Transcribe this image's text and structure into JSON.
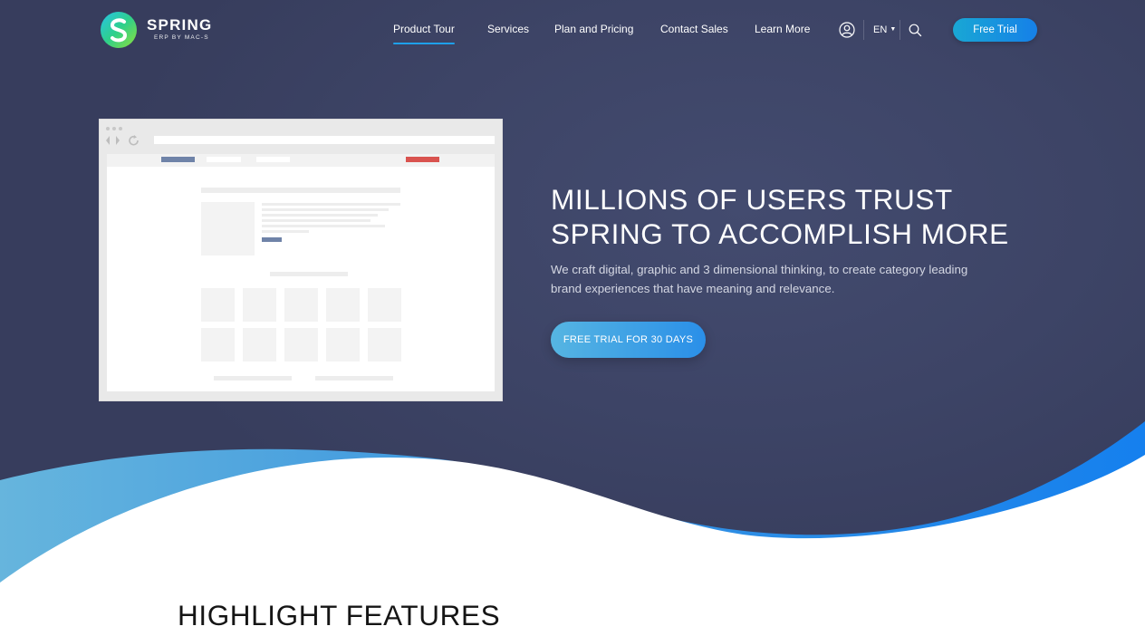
{
  "brand": {
    "name": "SPRING",
    "tagline": "ERP BY MAC-S",
    "logo_icon": "spring-logo-icon"
  },
  "nav": {
    "items": [
      {
        "label": "Product Tour",
        "active": true
      },
      {
        "label": "Services",
        "active": false
      },
      {
        "label": "Plan and Pricing",
        "active": false
      },
      {
        "label": "Contact Sales",
        "active": false
      },
      {
        "label": "Learn More",
        "active": false
      }
    ],
    "account_icon": "user-icon",
    "language": "EN",
    "language_icon": "caret-down-icon",
    "search_icon": "search-icon",
    "free_trial_label": "Free Trial"
  },
  "hero": {
    "title_line1": "MILLIONS OF USERS TRUST",
    "title_line2": "SPRING TO ACCOMPLISH MORE",
    "description_line1": "We craft digital, graphic and 3 dimensional thinking, to create category leading",
    "description_line2": "brand experiences that have meaning and relevance.",
    "cta_label": "FREE TRIAL FOR 30 DAYS"
  },
  "features": {
    "title": "HIGHLIGHT FEATURES"
  },
  "colors": {
    "hero_bg": "#3d4466",
    "accent_blue": "#1680e8",
    "wave_light": "#5ab0dc",
    "nav_underline": "#1ea0ea",
    "mockup_bar_blue": "#6f83a8",
    "mockup_bar_red": "#d9534f"
  }
}
